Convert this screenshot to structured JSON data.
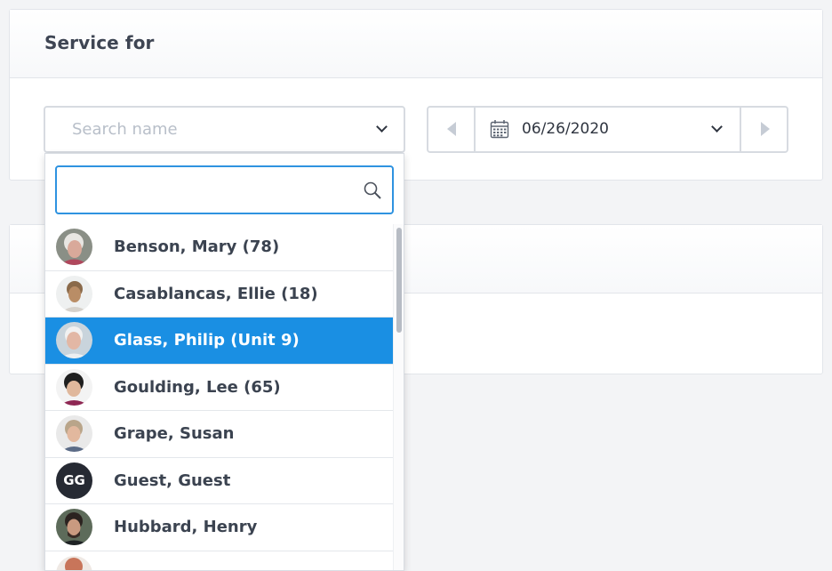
{
  "section": {
    "title": "Service for"
  },
  "name_select": {
    "placeholder": "Search name",
    "icon": "chevron-down-icon"
  },
  "date_picker": {
    "value": "06/26/2020",
    "prev_icon": "caret-left-icon",
    "next_icon": "caret-right-icon",
    "calendar_icon": "calendar-icon"
  },
  "dropdown": {
    "search_value": "",
    "search_icon": "search-icon",
    "items": [
      {
        "label": "Benson, Mary (78)",
        "avatar": "photo",
        "selected": false
      },
      {
        "label": "Casablancas, Ellie (18)",
        "avatar": "photo",
        "selected": false
      },
      {
        "label": "Glass, Philip (Unit 9)",
        "avatar": "photo",
        "selected": true
      },
      {
        "label": "Goulding, Lee (65)",
        "avatar": "photo",
        "selected": false
      },
      {
        "label": "Grape, Susan",
        "avatar": "photo",
        "selected": false
      },
      {
        "label": "Guest, Guest",
        "avatar": "initials",
        "initials": "GG",
        "selected": false
      },
      {
        "label": "Hubbard, Henry",
        "avatar": "photo",
        "selected": false
      }
    ]
  },
  "colors": {
    "accent": "#1a8fe3",
    "focus_border": "#2f93e0"
  }
}
